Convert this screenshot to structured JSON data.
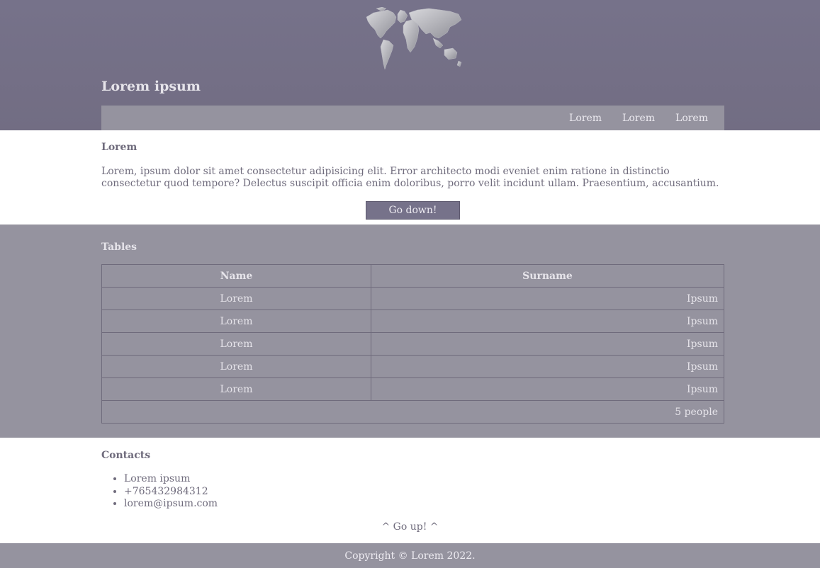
{
  "header": {
    "title": "Lorem ipsum",
    "logo_icon": "world-map-icon",
    "nav": [
      "Lorem",
      "Lorem",
      "Lorem"
    ]
  },
  "intro": {
    "heading": "Lorem",
    "paragraph": "Lorem, ipsum dolor sit amet consectetur adipisicing elit. Error architecto modi eveniet enim ratione in distinctio consectetur quod tempore? Delectus suscipit officia enim doloribus, porro velit incidunt ullam. Praesentium, accusantium.",
    "button": "Go down!"
  },
  "tables": {
    "heading": "Tables",
    "columns": [
      "Name",
      "Surname"
    ],
    "rows": [
      [
        "Lorem",
        "Ipsum"
      ],
      [
        "Lorem",
        "Ipsum"
      ],
      [
        "Lorem",
        "Ipsum"
      ],
      [
        "Lorem",
        "Ipsum"
      ],
      [
        "Lorem",
        "Ipsum"
      ]
    ],
    "footer": "5 people"
  },
  "contacts": {
    "heading": "Contacts",
    "items": [
      "Lorem ipsum",
      "+765432984312",
      "lorem@ipsum.com"
    ],
    "go_up": "^ Go up! ^"
  },
  "footer": {
    "copyright": "Copyright © Lorem 2022."
  },
  "colors": {
    "header_bg": "#76728a",
    "nav_bg": "#95939f",
    "section_bg": "#95939f",
    "text_dark": "#6f6b7c",
    "text_light": "#e6e4ea"
  }
}
